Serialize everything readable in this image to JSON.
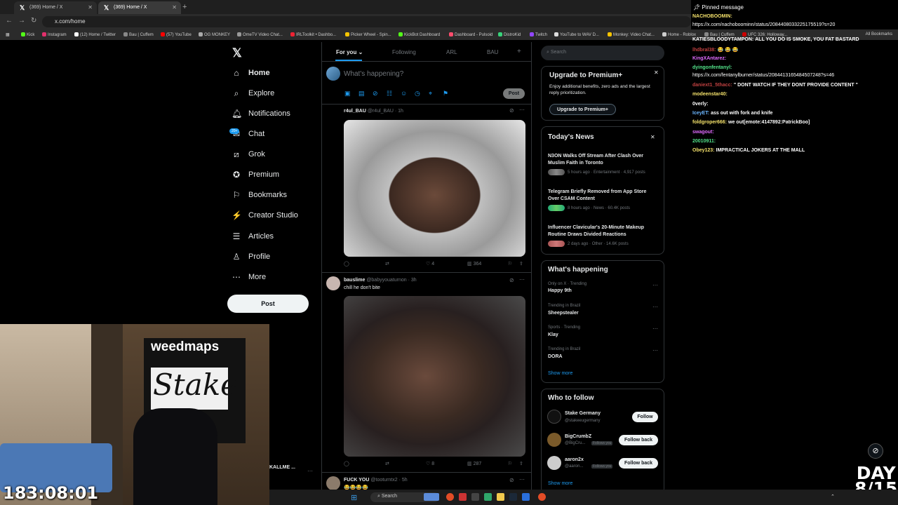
{
  "browser": {
    "tabs": [
      {
        "label": "(369) Home / X"
      },
      {
        "label": "(369) Home / X"
      }
    ],
    "url": "x.com/home",
    "bookmarks": [
      "Kick",
      "Instagram",
      "(12) Home / Twitter",
      "Bau | Cuffem",
      "(57) YouTube",
      "OG MONKEY",
      "OmeTV Video Chat...",
      "IRLToolkit • Dashbo...",
      "Picker Wheel - Spin...",
      "KickBot Dashboard",
      "Dashboard - Pulsoid",
      "DistroKid",
      "Twitch",
      "YouTube to WAV D...",
      "Monkey: Video Chat...",
      "Home - Roblox",
      "Bau | Cuffem",
      "UFC 326: Holloway..."
    ],
    "all_bookmarks": "All Bookmarks",
    "colors": {
      "tab_bg": "#1f1f1f",
      "toolbar": "#2b2b2b"
    }
  },
  "sidebar": {
    "items": [
      {
        "label": "Home",
        "icon": "home-icon"
      },
      {
        "label": "Explore",
        "icon": "search-icon"
      },
      {
        "label": "Notifications",
        "icon": "bell-icon"
      },
      {
        "label": "Chat",
        "icon": "chat-icon"
      },
      {
        "label": "Grok",
        "icon": "grok-icon"
      },
      {
        "label": "Premium",
        "icon": "premium-icon"
      },
      {
        "label": "Bookmarks",
        "icon": "bookmark-icon"
      },
      {
        "label": "Creator Studio",
        "icon": "creator-icon"
      },
      {
        "label": "Articles",
        "icon": "articles-icon"
      },
      {
        "label": "Profile",
        "icon": "person-icon"
      },
      {
        "label": "More",
        "icon": "more-icon"
      }
    ],
    "chat_badge": "20+",
    "post_label": "Post",
    "account_name": "KALLME ..."
  },
  "feed": {
    "tabs": [
      "For you",
      "Following",
      "ARL",
      "BAU"
    ],
    "composer_placeholder": "What's happening?",
    "composer_post": "Post",
    "tweets": [
      {
        "name": "r4ul_BAU",
        "handle": "@r4ul_BAU · 1h",
        "text": "",
        "likes": "4",
        "views": "364"
      },
      {
        "name": "bauslime",
        "handle": "@babyyouaturnon · 3h",
        "text": "chill he don't bite",
        "likes": "8",
        "views": "287"
      },
      {
        "name": "FUCK YOU",
        "handle": "@tooturntx2 · 5h",
        "text": "😂😂😂😂",
        "likes": "",
        "views": ""
      }
    ]
  },
  "right": {
    "search_placeholder": "Search",
    "premium": {
      "title": "Upgrade to Premium+",
      "body": "Enjoy additional benefits, zero ads and the largest reply prioritization.",
      "button": "Upgrade to Premium+"
    },
    "news": {
      "title": "Today's News",
      "items": [
        {
          "headline": "N3ON Walks Off Stream After Clash Over Muslim Faith in Toronto",
          "meta": "5 hours ago · Entertainment · 4,917 posts"
        },
        {
          "headline": "Telegram Briefly Removed from App Store Over CSAM Content",
          "meta": "8 hours ago · News · 60.4K posts"
        },
        {
          "headline": "Influencer Clavicular's 20-Minute Makeup Routine Draws Divided Reactions",
          "meta": "2 days ago · Other · 14.6K posts"
        }
      ]
    },
    "happening": {
      "title": "What's happening",
      "items": [
        {
          "context": "Only on X · Trending",
          "name": "Happy 9th"
        },
        {
          "context": "Trending in Brazil",
          "name": "Sheepstealer"
        },
        {
          "context": "Sports · Trending",
          "name": "Klay"
        },
        {
          "context": "Trending in Brazil",
          "name": "DORA"
        }
      ],
      "show_more": "Show more"
    },
    "follow": {
      "title": "Who to follow",
      "items": [
        {
          "name": "Stake Germany",
          "handle": "@stakeeugermany",
          "follows_you": "",
          "button": "Follow"
        },
        {
          "name": "BigCrumbZ",
          "handle": "@BigCru...",
          "follows_you": "Follows you",
          "button": "Follow back"
        },
        {
          "name": "aaron2x",
          "handle": "@aaron...",
          "follows_you": "Follows you",
          "button": "Follow back"
        }
      ],
      "show_more": "Show more"
    }
  },
  "chat_overlay": {
    "pinned": "Pinned message",
    "lines": [
      {
        "user": "NACHOBOOMIN:",
        "color": "#f5e26b",
        "text": ""
      },
      {
        "user": "",
        "color": "#ffffff",
        "text": "https://x.com/nachoboominn/status/2084408033225175519?s=20"
      },
      {
        "user": "KATIESBLOODYTAMPON:",
        "color": "#ffffff",
        "text": "ALL YOU DO IS SMOKE, YOU FAT BASTARD"
      },
      {
        "user": "lhdbral38:",
        "color": "#c04040",
        "text": "😂 😂 😂"
      },
      {
        "user": "KingXAntarez:",
        "color": "#e06bff",
        "text": ""
      },
      {
        "user": "dyingonfentanyl:",
        "color": "#53e28a",
        "text": ""
      },
      {
        "user": "",
        "color": "#ffffff",
        "text": "https://x.com/fentanylburner/status/2084413165484507248?s=46"
      },
      {
        "user": "daniext1_5thacc:",
        "color": "#c04040",
        "text": "\" DONT WATCH IF THEY DONT PROVIDE CONTENT \""
      },
      {
        "user": "modeenstar40:",
        "color": "#f5e26b",
        "text": ""
      },
      {
        "user": "0verly:",
        "color": "#ffffff",
        "text": ""
      },
      {
        "user": "IceyET:",
        "color": "#6bb6ff",
        "text": "ass out with fork and knife"
      },
      {
        "user": "foldgroper666:",
        "color": "#f5e26b",
        "text": "we out[emote:4147892:PatrickBoo]"
      },
      {
        "user": "swagout:",
        "color": "#e06bff",
        "text": ""
      },
      {
        "user": "20010911:",
        "color": "#53e28a",
        "text": ""
      },
      {
        "user": "Obey123:",
        "color": "#f5e26b",
        "text": "IMPRACTICAL JOKERS AT THE MALL"
      }
    ]
  },
  "stream": {
    "timer": "183:08:01",
    "day_label": "DAY",
    "day_value": "8/15",
    "webcam_banner": "weedmaps",
    "webcam_sign": "Stake"
  },
  "taskbar": {
    "search": "Search"
  }
}
